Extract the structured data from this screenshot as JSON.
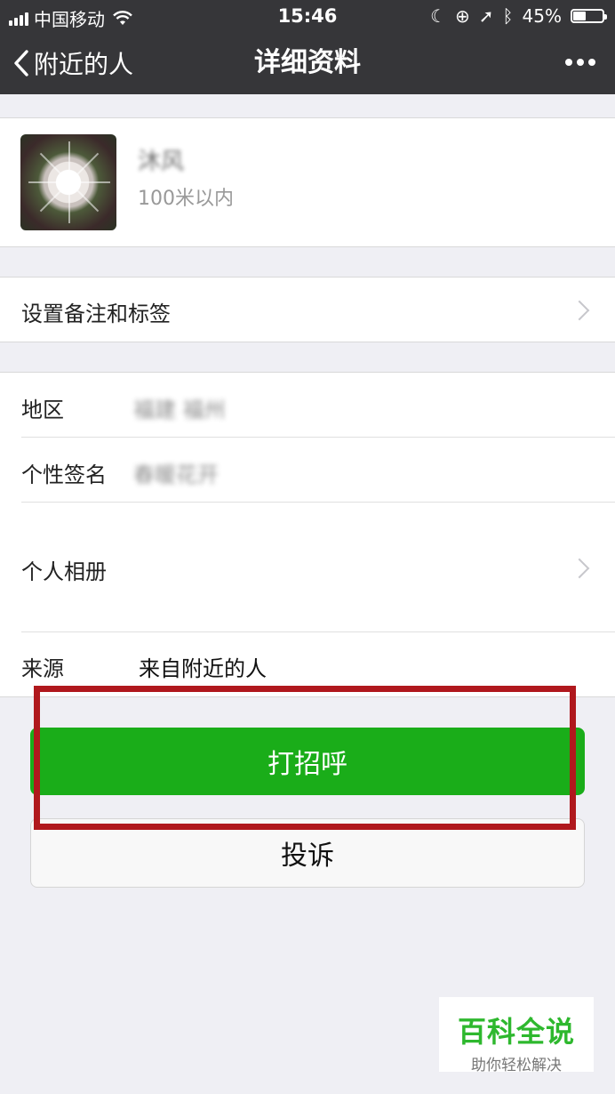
{
  "status_bar": {
    "carrier": "中国移动",
    "time": "15:46",
    "battery": "45%",
    "battery_level": 0.45
  },
  "nav": {
    "back_label": "附近的人",
    "title": "详细资料",
    "more_icon": "more-dots-icon"
  },
  "profile": {
    "nickname": "沐风",
    "distance": "100米以内"
  },
  "remark_row": {
    "label": "设置备注和标签"
  },
  "info": {
    "region_label": "地区",
    "region_value": "福建 福州",
    "signature_label": "个性签名",
    "signature_value": "春暖花开",
    "album_label": "个人相册",
    "source_label": "来源",
    "source_value": "来自附近的人"
  },
  "buttons": {
    "greet": "打招呼",
    "report": "投诉"
  },
  "watermark": {
    "title": "百科全说",
    "subtitle": "助你轻松解决"
  },
  "colors": {
    "nav_bg": "#363639",
    "green": "#1aad19",
    "highlight": "#b0181d",
    "page_bg": "#efeff4"
  }
}
